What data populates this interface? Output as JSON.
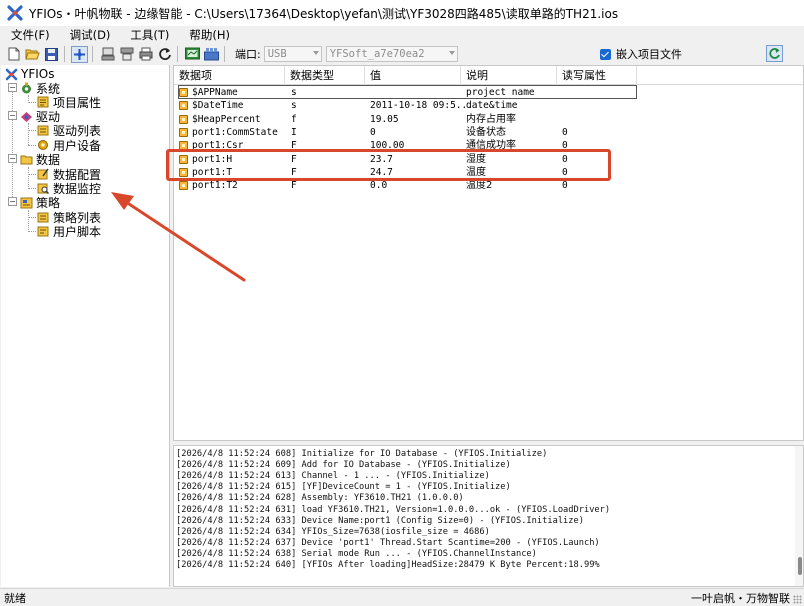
{
  "window": {
    "title": "YFIOs・叶帆物联 - 边缘智能 - C:\\Users\\17364\\Desktop\\yefan\\测试\\YF3028四路485\\读取单路的TH21.ios"
  },
  "menu": {
    "items": [
      "文件(F)",
      "调试(D)",
      "工具(T)",
      "帮助(H)"
    ]
  },
  "toolbar": {
    "port_label": "端口:",
    "port_value": "USB",
    "project_value": "YFSoft_a7e70ea2",
    "embed_checked": true,
    "embed_label": "嵌入项目文件"
  },
  "tree": {
    "root": "YFIOs",
    "system": "系统",
    "project_props": "项目属性",
    "driver": "驱动",
    "driver_list": "驱动列表",
    "user_device": "用户设备",
    "data": "数据",
    "data_config": "数据配置",
    "data_monitor": "数据监控",
    "strategy": "策略",
    "strategy_list": "策略列表",
    "user_script": "用户脚本"
  },
  "table": {
    "headers": [
      "数据项",
      "数据类型",
      "值",
      "说明",
      "读写属性"
    ],
    "rows": [
      {
        "name": "$APPName",
        "type": "s",
        "value": "",
        "desc": "project name",
        "rw": ""
      },
      {
        "name": "$DateTime",
        "type": "s",
        "value": "2011-10-18 09:5...",
        "desc": "date&time",
        "rw": ""
      },
      {
        "name": "$HeapPercent",
        "type": "f",
        "value": "19.05",
        "desc": "内存占用率",
        "rw": ""
      },
      {
        "name": "port1:CommState",
        "type": "I",
        "value": "0",
        "desc": "设备状态",
        "rw": "0"
      },
      {
        "name": "port1:Csr",
        "type": "F",
        "value": "100.00",
        "desc": "通信成功率",
        "rw": "0"
      },
      {
        "name": "port1:H",
        "type": "F",
        "value": "23.7",
        "desc": "湿度",
        "rw": "0"
      },
      {
        "name": "port1:T",
        "type": "F",
        "value": "24.7",
        "desc": "温度",
        "rw": "0"
      },
      {
        "name": "port1:T2",
        "type": "F",
        "value": "0.0",
        "desc": "温度2",
        "rw": "0"
      }
    ]
  },
  "log": {
    "lines": [
      "[2026/4/8 11:52:24 608] Initialize for IO Database - (YFIOS.Initialize)",
      "[2026/4/8 11:52:24 609] Add for IO Database - (YFIOS.Initialize)",
      "[2026/4/8 11:52:24 613] Channel - 1 ... - (YFIOS.Initialize)",
      "[2026/4/8 11:52:24 615] [YF]DeviceCount = 1 - (YFIOS.Initialize)",
      "[2026/4/8 11:52:24 628] Assembly: YF3610.TH21 (1.0.0.0)",
      "[2026/4/8 11:52:24 631] load YF3610.TH21, Version=1.0.0.0...ok - (YFIOS.LoadDriver)",
      "[2026/4/8 11:52:24 633] Device Name:port1 (Config Size=0) - (YFIOS.Initialize)",
      "[2026/4/8 11:52:24 634] YFIOs_Size=7638(iosfile_size = 4686)",
      "[2026/4/8 11:52:24 637] Device 'port1' Thread.Start Scantime=200 - (YFIOS.Launch)",
      "[2026/4/8 11:52:24 638] Serial mode Run ... - (YFIOS.ChannelInstance)",
      "[2026/4/8 11:52:24 640] [YFIOs After loading]HeadSize:28479 K Byte Percent:18.99%"
    ]
  },
  "status": {
    "left": "就绪",
    "right": "一叶启帆・万物智联"
  },
  "colors": {
    "highlight_red": "#d9472b",
    "accent_blue": "#1769d1"
  }
}
